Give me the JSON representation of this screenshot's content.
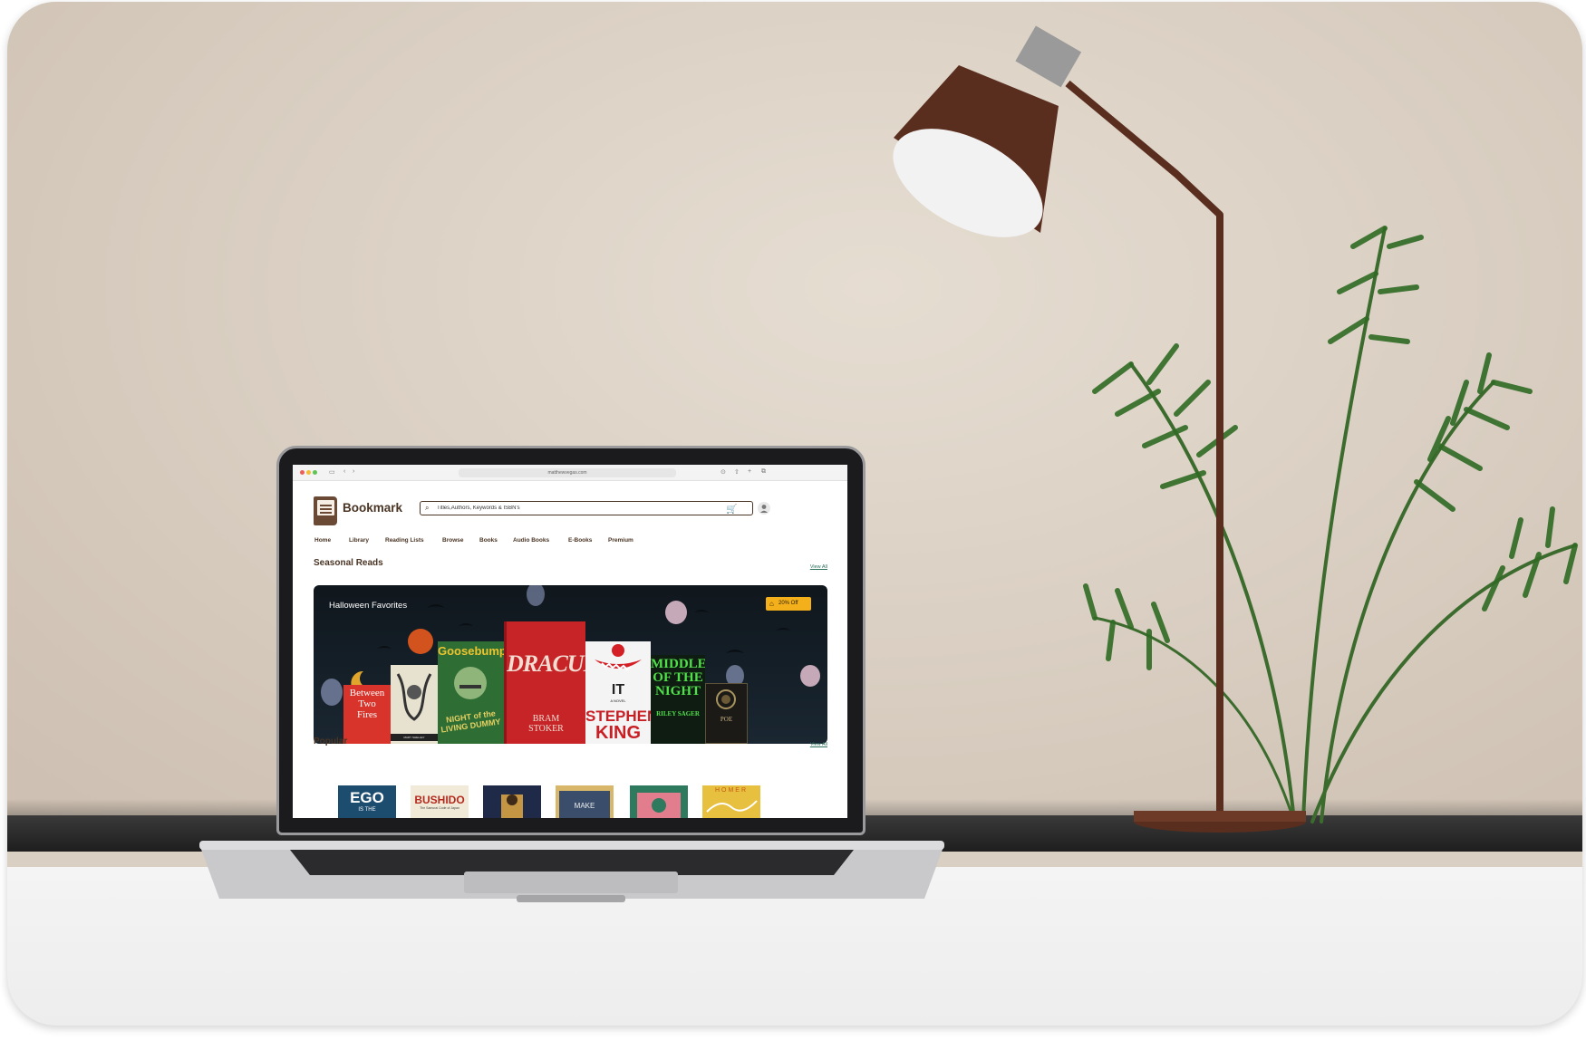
{
  "browser": {
    "url": "matthewvegas.com"
  },
  "header": {
    "brand": "Bookmark",
    "search_placeholder": "Titles,Authors, Keywords & ISBN's"
  },
  "nav": {
    "items": [
      "Home",
      "Library",
      "Reading Lists",
      "Browse",
      "Books",
      "Audio Books",
      "E-Books",
      "Premium"
    ]
  },
  "seasonal": {
    "title": "Seasonal Reads",
    "view_all": "View All",
    "banner_title": "Halloween Favorites",
    "promo": "20% Off",
    "books": [
      {
        "lines": [
          "Between",
          "Two",
          "Fires"
        ]
      },
      {
        "lines": [
          "MARY SHELLEY"
        ]
      },
      {
        "lines": [
          "Goosebumps",
          "NIGHT of the",
          "LIVING DUMMY"
        ]
      },
      {
        "lines": [
          "DRACULA",
          "BRAM",
          "STOKER"
        ]
      },
      {
        "lines": [
          "IT",
          "A NOVEL",
          "STEPHEN",
          "KING"
        ]
      },
      {
        "lines": [
          "MIDDLE",
          "OF THE",
          "NIGHT",
          "RILEY SAGER"
        ]
      },
      {
        "lines": [
          "POE"
        ]
      }
    ]
  },
  "popular": {
    "title": "Popular",
    "view_all": "View All",
    "books": [
      {
        "lines": [
          "EGO",
          "IS THE"
        ]
      },
      {
        "lines": [
          "BUSHIDO",
          "The Samurai Code of Japan"
        ]
      },
      {
        "lines": [
          ""
        ]
      },
      {
        "lines": [
          "MAKE"
        ]
      },
      {
        "lines": [
          ""
        ]
      },
      {
        "lines": [
          "HOMER"
        ]
      }
    ]
  },
  "colors": {
    "brand_brown": "#4a3424",
    "promo_yellow": "#f3b01b",
    "link_green": "#2a6f5a",
    "banner_dark": "#10171d"
  }
}
